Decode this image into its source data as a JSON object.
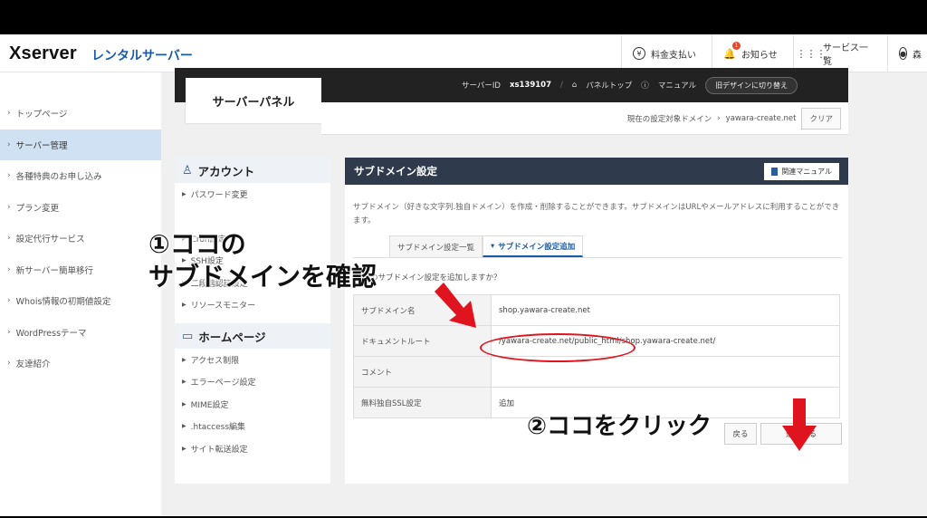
{
  "header": {
    "logo": "Xserver",
    "logo_sub": "レンタルサーバー",
    "nav": {
      "billing": "料金支払い",
      "notice": "お知らせ",
      "notice_badge": "1",
      "services": "サービス一覧",
      "user": "森"
    }
  },
  "sidebar": {
    "items": [
      {
        "label": "トップページ"
      },
      {
        "label": "サーバー管理"
      },
      {
        "label": "各種特典のお申し込み"
      },
      {
        "label": "プラン変更"
      },
      {
        "label": "設定代行サービス"
      },
      {
        "label": "新サーバー簡単移行"
      },
      {
        "label": "Whois情報の初期値設定"
      },
      {
        "label": "WordPressテーマ"
      },
      {
        "label": "友達紹介"
      }
    ]
  },
  "panel": {
    "title": "サーバーパネル",
    "server_id_label": "サーバーID",
    "server_id": "xs139107",
    "panel_top": "パネルトップ",
    "manual": "マニュアル",
    "switch_design": "旧デザインに切り替え",
    "target_domain_label": "現在の設定対象ドメイン",
    "target_domain": "yawara-create.net",
    "clear": "クリア"
  },
  "account_menu": {
    "header": "アカウント",
    "items": [
      "パスワード変更",
      "Cron設定",
      "SSH設定",
      "二段階認証設定",
      "リソースモニター"
    ],
    "homepage_header": "ホームページ",
    "homepage_items": [
      "アクセス制限",
      "エラーページ設定",
      "MIME設定",
      ".htaccess編集",
      "サイト転送設定"
    ]
  },
  "content": {
    "title": "サブドメイン設定",
    "manual_button": "関連マニュアル",
    "description": "サブドメイン（好きな文字列.独自ドメイン）を作成・削除することができます。サブドメインはURLやメールアドレスに利用することができます。",
    "tabs": [
      "サブドメイン設定一覧",
      "サブドメイン設定追加"
    ],
    "confirm": "以下のサブドメイン設定を追加しますか？",
    "rows": [
      {
        "label": "サブドメイン名",
        "value": "shop.yawara-create.net"
      },
      {
        "label": "ドキュメントルート",
        "value": "/yawara-create.net/public_html/shop.yawara-create.net/"
      },
      {
        "label": "コメント",
        "value": ""
      },
      {
        "label": "無料独自SSL設定",
        "value": "追加"
      }
    ],
    "back_button": "戻る",
    "add_button": "追加する"
  },
  "annotations": {
    "step1_line1": "①ココの",
    "step1_line2": "サブドメインを確認",
    "step2": "②ココをクリック",
    "color": "#e0141e"
  },
  "colors": {
    "brand": "#1a5ba6",
    "panel_dark": "#222222",
    "content_head": "#2f3b4c",
    "sidebar_active": "#cfe1f3"
  }
}
